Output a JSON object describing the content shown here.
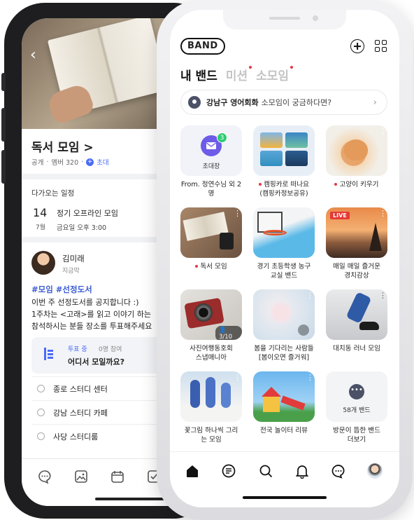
{
  "back_phone": {
    "band_title": "독서 모임 >",
    "visibility": "공개",
    "members": "멤버 320",
    "invite": "초대",
    "upcoming_label": "다가오는 일정",
    "event": {
      "day": "14",
      "month": "7월",
      "title": "정기 오프라인 모임",
      "time": "금요일 오후 3:00"
    },
    "post": {
      "author": "김미래",
      "time": "지금막",
      "tags": "#모임 #선정도서",
      "lines": [
        "이번 주 선정도서를 공지합니다 :)",
        "1주차는 <고래>를 읽고 이야기 하는",
        "참석하시는 분들 장소를 투표해주세요"
      ]
    },
    "vote": {
      "status": "투표 중",
      "count": "0명 참여",
      "question": "어디서 모일까요?"
    },
    "options": [
      "종로 스터디 센터",
      "강남 스터디 카페",
      "사당 스터디룸"
    ],
    "tab_icons": [
      "chat-bubble-icon",
      "image-icon",
      "calendar-icon",
      "checkbox-icon"
    ]
  },
  "front_phone": {
    "logo": "BAND",
    "tabs": [
      {
        "label": "내 밴드",
        "active": true,
        "dot": false
      },
      {
        "label": "미션",
        "active": false,
        "dot": true
      },
      {
        "label": "소모임",
        "active": false,
        "dot": true
      }
    ],
    "location_bar": {
      "strong": "강남구 영어회화",
      "rest": "소모임이 궁금하다면?"
    },
    "tiles": [
      {
        "line1": "From. 정연수님 외 2",
        "line2": "명",
        "dot": false,
        "badge_label": "초대장",
        "badge_count": "3"
      },
      {
        "line1": "캠핑카로 떠나요",
        "line2": "(캠핑카정보공유)",
        "dot": true
      },
      {
        "line1": "고양이 키우기",
        "line2": "",
        "dot": true
      },
      {
        "line1": "독서 모임",
        "line2": "",
        "dot": true
      },
      {
        "line1": "경기 초등학생 농구",
        "line2": "교실 밴드",
        "dot": false
      },
      {
        "line1": "매일 매일 즐거운",
        "line2": "경치감상",
        "dot": false,
        "live": "LIVE"
      },
      {
        "line1": "사진여행동호회",
        "line2": "스냅매니아",
        "dot": false,
        "members": "3/10"
      },
      {
        "line1": "봄을 기다리는 사람들",
        "line2": "[봄이오면 즐거워]",
        "dot": false
      },
      {
        "line1": "대치동 러너 모임",
        "line2": "",
        "dot": false
      },
      {
        "line1": "꽃그림 하나씩 그리",
        "line2": "는 모임",
        "dot": false
      },
      {
        "line1": "전국 놀이터 리뷰",
        "line2": "",
        "dot": false
      },
      {
        "line1": "방문이 뜸한 밴드",
        "line2": "더보기",
        "dot": false,
        "more_count": "58개 밴드"
      }
    ],
    "tab_icons": [
      "home-icon",
      "feed-icon",
      "search-icon",
      "bell-icon",
      "chat-icon",
      "profile-avatar"
    ]
  }
}
